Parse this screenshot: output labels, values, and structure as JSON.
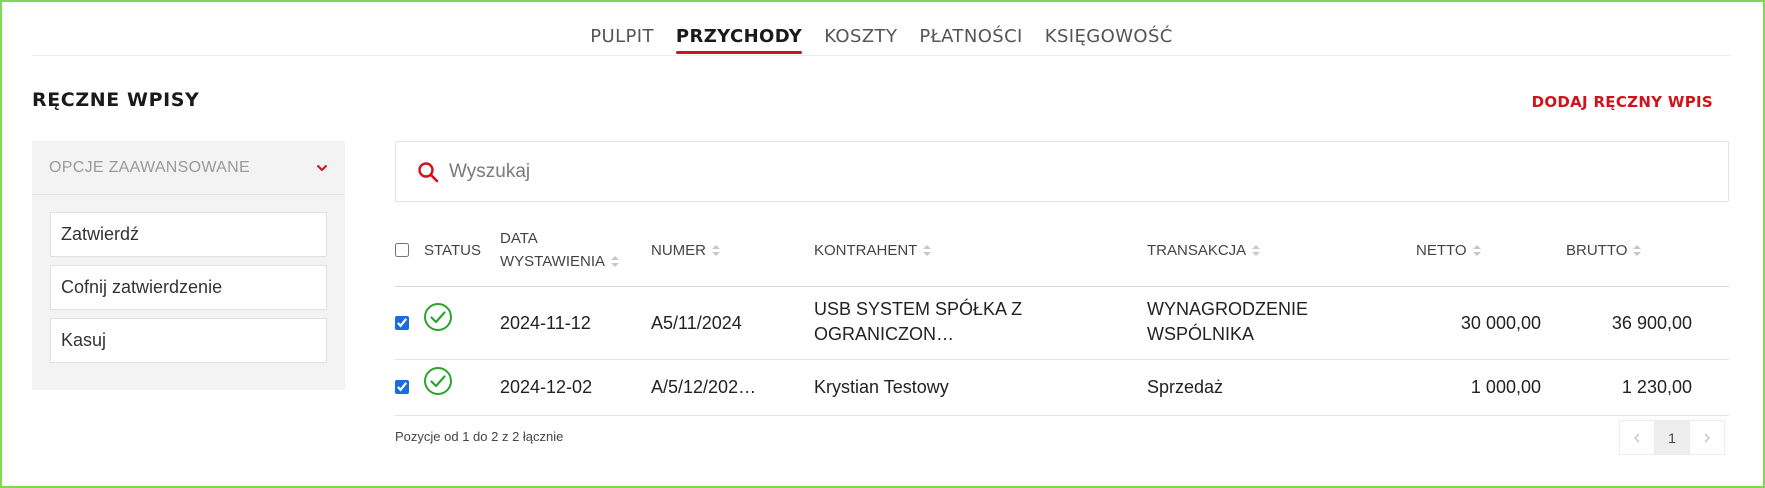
{
  "nav": {
    "tabs": [
      {
        "label": "PULPIT"
      },
      {
        "label": "PRZYCHODY",
        "active": true
      },
      {
        "label": "KOSZTY"
      },
      {
        "label": "PŁATNOŚCI"
      },
      {
        "label": "KSIĘGOWOŚĆ"
      }
    ]
  },
  "section": {
    "title": "RĘCZNE WPISY",
    "add_label": "DODAJ RĘCZNY WPIS"
  },
  "sidebar": {
    "header": "OPCJE ZAAWANSOWANE",
    "header_icon": "chevron-down-icon",
    "actions": [
      "Zatwierdź",
      "Cofnij zatwierdzenie",
      "Kasuj"
    ]
  },
  "search": {
    "placeholder": "Wyszukaj",
    "value": "",
    "icon": "search-icon"
  },
  "table": {
    "headers": {
      "status": "STATUS",
      "date_line1": "DATA",
      "date_line2": "WYSTAWIENIA",
      "number": "NUMER",
      "contractor": "KONTRAHENT",
      "transaction": "TRANSAKCJA",
      "net": "NETTO",
      "gross": "BRUTTO"
    },
    "select_all_checked": false,
    "rows": [
      {
        "checked": true,
        "status_icon": "check-circle-icon",
        "date": "2024-11-12",
        "number": "A5/11/2024",
        "contractor_line1": "USB SYSTEM SPÓŁKA Z",
        "contractor_line2": "OGRANICZON…",
        "transaction_line1": "WYNAGRODZENIE",
        "transaction_line2": "WSPÓLNIKA",
        "net": "30 000,00",
        "gross": "36 900,00"
      },
      {
        "checked": true,
        "status_icon": "check-circle-icon",
        "date": "2024-12-02",
        "number": "A/5/12/202…",
        "contractor_line1": "Krystian Testowy",
        "transaction_line1": "Sprzedaż",
        "net": "1 000,00",
        "gross": "1 230,00"
      }
    ]
  },
  "footer": {
    "info": "Pozycje od 1 do 2 z 2 łącznie",
    "current_page": "1"
  },
  "colors": {
    "accent": "#d0121b",
    "success": "#2aa52a",
    "frame": "#7ed957"
  }
}
